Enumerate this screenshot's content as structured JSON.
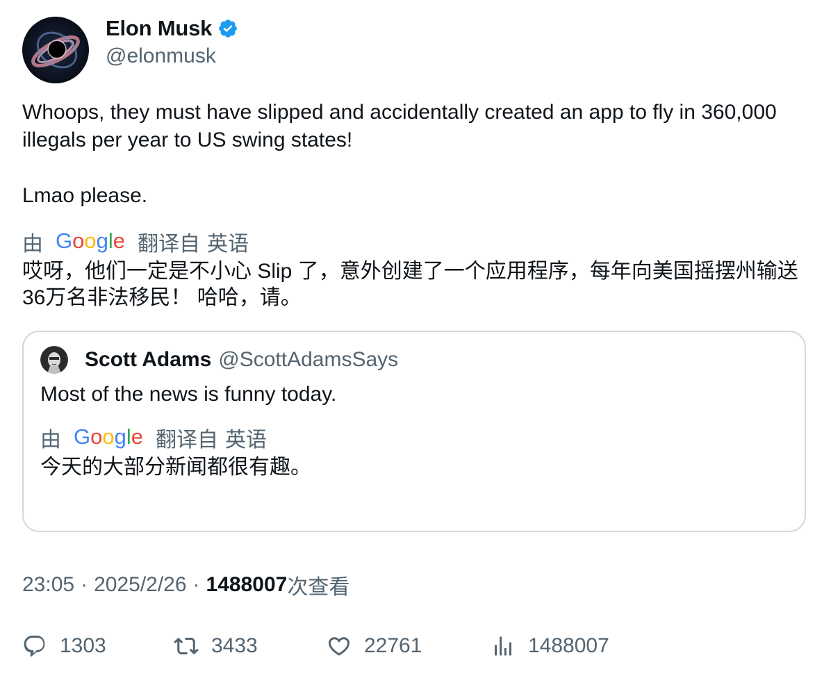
{
  "author": {
    "name": "Elon Musk",
    "handle": "@elonmusk",
    "verified": true,
    "avatar_icon": "black-hole-avatar-icon"
  },
  "tweet": {
    "text": "Whoops, they must have slipped and accidentally created an app to fly in 360,000 illegals per year to US swing states!\n\nLmao please."
  },
  "translation": {
    "by_label": "由",
    "provider": "Google",
    "from_label": "翻译自",
    "language": "英语",
    "text": "哎呀，他们一定是不小心 Slip 了，意外创建了一个应用程序，每年向美国摇摆州输送36万名非法移民！ 哈哈，请。"
  },
  "quoted": {
    "name": "Scott Adams",
    "handle": "@ScottAdamsSays",
    "text": "Most of the news is funny today.",
    "translation": {
      "by_label": "由",
      "provider": "Google",
      "from_label": "翻译自",
      "language": "英语",
      "text": "今天的大部分新闻都很有趣。"
    }
  },
  "meta": {
    "time": "23:05",
    "separator": "·",
    "date": "2025/2/26",
    "views": "1488007",
    "views_label": "次查看"
  },
  "actions": {
    "replies": "1303",
    "retweets": "3433",
    "likes": "22761",
    "views": "1488007"
  },
  "colors": {
    "text": "#0f1419",
    "secondary": "#536471",
    "border": "#cfd9de",
    "verified": "#1d9bf0"
  }
}
